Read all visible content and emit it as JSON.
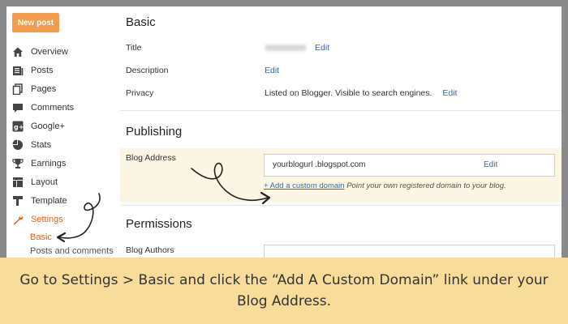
{
  "sidebar": {
    "new_post": "New post",
    "items": [
      {
        "label": "Overview",
        "icon": "home-icon"
      },
      {
        "label": "Posts",
        "icon": "posts-icon"
      },
      {
        "label": "Pages",
        "icon": "pages-icon"
      },
      {
        "label": "Comments",
        "icon": "comments-icon"
      },
      {
        "label": "Google+",
        "icon": "google-plus-icon"
      },
      {
        "label": "Stats",
        "icon": "stats-icon"
      },
      {
        "label": "Earnings",
        "icon": "trophy-icon"
      },
      {
        "label": "Layout",
        "icon": "layout-icon"
      },
      {
        "label": "Template",
        "icon": "template-icon"
      },
      {
        "label": "Settings",
        "icon": "wrench-icon"
      }
    ],
    "sub_active": "Basic",
    "sub_next": "Posts and comments"
  },
  "basic": {
    "title": "Basic",
    "title_label": "Title",
    "title_edit": "Edit",
    "description_label": "Description",
    "description_edit": "Edit",
    "privacy_label": "Privacy",
    "privacy_value": "Listed on Blogger. Visible to search engines.",
    "privacy_edit": "Edit"
  },
  "publishing": {
    "title": "Publishing",
    "blog_address_label": "Blog Address",
    "address_value": "yourblogurl .blogspot.com",
    "address_edit": "Edit",
    "custom_domain_link": "+ Add a custom domain",
    "custom_domain_hint": "Point your own registered domain to your blog."
  },
  "permissions": {
    "title": "Permissions",
    "blog_authors_label": "Blog Authors"
  },
  "caption": {
    "line1": "Go to Settings > Basic and click the “Add A Custom Domain” link under your",
    "line2": "Blog Address."
  },
  "colors": {
    "accent": "#e2641a",
    "button": "#f39c4b",
    "link": "#2a6cb8",
    "caption_bg": "#f8dc9a",
    "highlight_bg": "#fbf6e3"
  }
}
